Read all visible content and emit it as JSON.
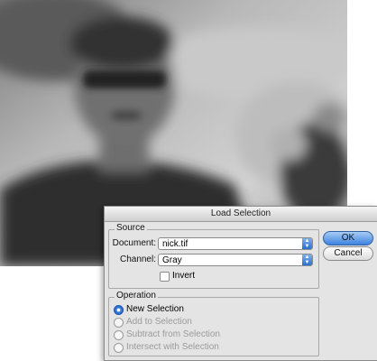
{
  "dialog": {
    "title": "Load Selection",
    "source": {
      "group_label": "Source",
      "document_label": "Document:",
      "document_value": "nick.tif",
      "channel_label": "Channel:",
      "channel_value": "Gray",
      "invert_label": "Invert",
      "invert_checked": false
    },
    "operation": {
      "group_label": "Operation",
      "options": [
        {
          "label": "New Selection",
          "selected": true,
          "enabled": true
        },
        {
          "label": "Add to Selection",
          "selected": false,
          "enabled": false
        },
        {
          "label": "Subtract from Selection",
          "selected": false,
          "enabled": false
        },
        {
          "label": "Intersect with Selection",
          "selected": false,
          "enabled": false
        }
      ]
    },
    "buttons": {
      "ok_label": "OK",
      "cancel_label": "Cancel"
    }
  },
  "colors": {
    "accent": "#3d83e0",
    "dialog_bg": "#e4e4e4",
    "disabled_text": "#9a9a9a"
  },
  "icons": [
    "popup-arrows-icon",
    "checkbox-icon",
    "radio-icon"
  ]
}
